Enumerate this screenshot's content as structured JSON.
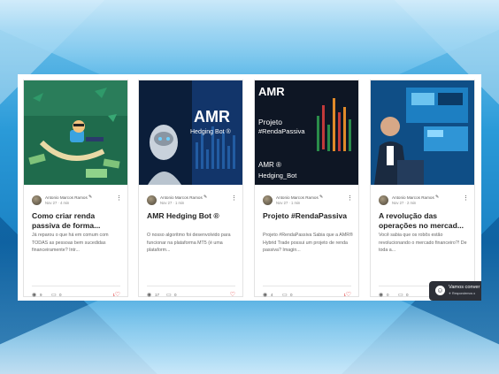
{
  "posts": [
    {
      "author": "Antonio Marcos Ramos",
      "date": "Nov 27 · 4 min",
      "title": "Como criar renda passiva de forma...",
      "excerpt": "Já reparou o que há em comum com TODAS as pessoas bem sucedidas financeiramente? Intr...",
      "views": "9",
      "comments": "0",
      "likes": "1",
      "image_label": ""
    },
    {
      "author": "Antonio Marcos Ramos",
      "date": "Nov 27 · 1 min",
      "title": "AMR Hedging Bot ®",
      "excerpt": "O nosso algoritmo foi desenvolvido para funcionar na plataforma MT5 (é uma plataform...",
      "views": "17",
      "comments": "0",
      "likes": "",
      "image_label": "AMR",
      "image_sub": "Hedging Bot ®"
    },
    {
      "author": "Antonio Marcos Ramos",
      "date": "Nov 27 · 1 min",
      "title": "Projeto #RendaPassiva",
      "excerpt": "Projeto #RendaPassiva Sabia que a AMR® Hybrid Trade possui um projeto de renda passiva? Imagin...",
      "views": "4",
      "comments": "0",
      "likes": "1",
      "image_label": "AMR",
      "image_lines": [
        "Projeto",
        "#RendaPassiva",
        "AMR ®",
        "Hedging_Bot"
      ]
    },
    {
      "author": "Antonio Marcos Ramos",
      "date": "Nov 27 · 2 min",
      "title": "A revolução das operações no mercad...",
      "excerpt": "Você sabia que os robôs estão revolucionando o mercado financeiro?! De toda a...",
      "views": "0",
      "comments": "0",
      "likes": "",
      "image_label": ""
    }
  ],
  "chat": {
    "title": "Vamos conver",
    "subtitle": "✈ Respondemos o"
  },
  "colors": {
    "accent": "#1d8fd0",
    "heart": "#e03030",
    "chat_bg": "#2c2f37"
  },
  "icons": [
    "pen-icon",
    "more-icon",
    "eye-icon",
    "comment-icon",
    "heart-icon",
    "chat-icon"
  ]
}
